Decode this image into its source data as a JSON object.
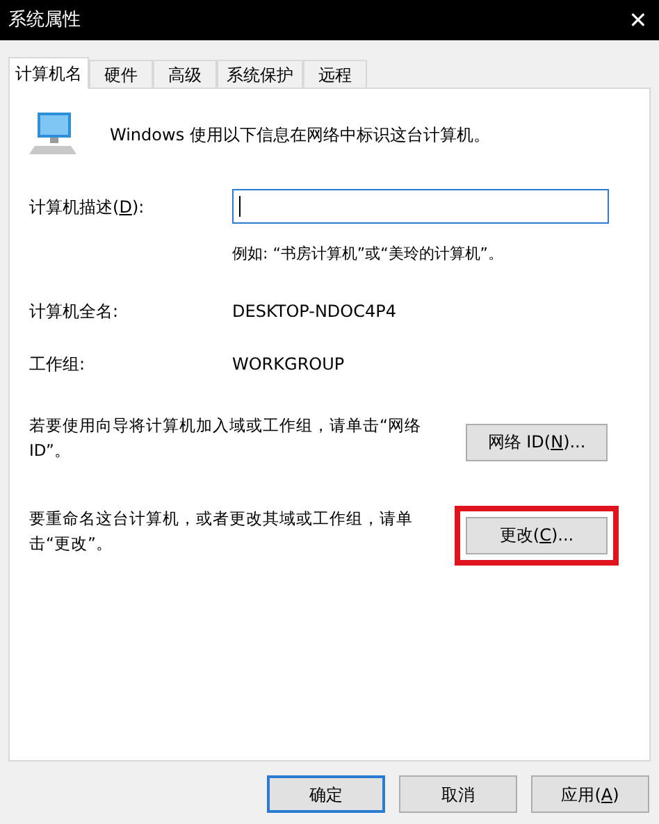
{
  "window": {
    "title": "系统属性",
    "close": "✕"
  },
  "tabs": [
    {
      "label": "计算机名",
      "selected": true
    },
    {
      "label": "硬件",
      "selected": false
    },
    {
      "label": "高级",
      "selected": false
    },
    {
      "label": "系统保护",
      "selected": false
    },
    {
      "label": "远程",
      "selected": false
    }
  ],
  "intro": "Windows 使用以下信息在网络中标识这台计算机。",
  "description": {
    "label_parts": [
      "计算机描述(",
      "D",
      "):"
    ],
    "focused": true,
    "example": "例如: “书房计算机”或“美玲的计算机”。"
  },
  "info_rows": [
    {
      "label": "计算机全名:",
      "value": "DESKTOP-NDOC4P4"
    },
    {
      "label": "工作组:",
      "value": "WORKGROUP"
    }
  ],
  "actions": [
    {
      "text": "若要使用向导将计算机加入域或工作组，请单击“网络 ID”。",
      "button_parts": [
        "网络 ID(",
        "N",
        ")..."
      ],
      "highlighted": false
    },
    {
      "text": "要重命名这台计算机，或者更改其域或工作组，请单击“更改”。",
      "button_parts": [
        "更改(",
        "C",
        ")..."
      ],
      "highlighted": true
    }
  ],
  "buttons": [
    {
      "label_parts": [
        "确定"
      ],
      "default": true
    },
    {
      "label_parts": [
        "取消"
      ],
      "default": false
    },
    {
      "label_parts": [
        "应用(",
        "A",
        ")"
      ],
      "default": false
    }
  ]
}
